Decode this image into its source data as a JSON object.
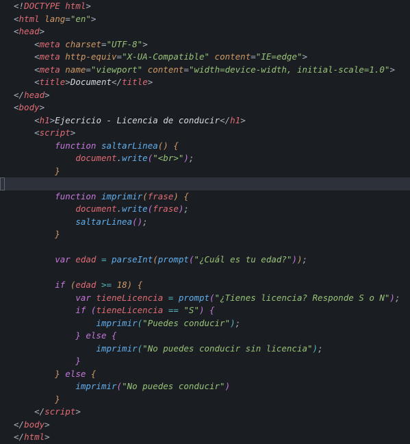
{
  "code": {
    "doctype": "DOCTYPE html",
    "html_tag": "html",
    "lang_attr": "lang",
    "lang_val": "\"en\"",
    "head_tag": "head",
    "meta_tag": "meta",
    "charset_attr": "charset",
    "charset_val": "\"UTF-8\"",
    "httpequiv_attr": "http-equiv",
    "httpequiv_val": "\"X-UA-Compatible\"",
    "content_attr": "content",
    "content_val1": "\"IE=edge\"",
    "name_attr": "name",
    "name_val": "\"viewport\"",
    "content_val2": "\"width=device-width, initial-scale=1.0\"",
    "title_tag": "title",
    "title_text": "Document",
    "body_tag": "body",
    "h1_tag": "h1",
    "h1_text": "Ejecricio - Licencia de conducir",
    "script_tag": "script",
    "function_kw": "function",
    "func_saltar": "saltarLinea",
    "func_imprimir": "imprimir",
    "param_frase": "frase",
    "document_obj": "document",
    "write_method": "write",
    "br_str": "\"<br>\"",
    "var_kw": "var",
    "var_edad": "edad",
    "parseInt_fn": "parseInt",
    "prompt_fn": "prompt",
    "prompt_edad": "\"¿Cuál es tu edad?\"",
    "if_kw": "if",
    "else_kw": "else",
    "gte": ">=",
    "eq": "==",
    "num_18": "18",
    "var_licencia": "tieneLicencia",
    "prompt_licencia": "\"¿Tienes licencia? Responde S o N\"",
    "str_S": "\"S\"",
    "str_puedes": "\"Puedes conducir\"",
    "str_sinlic": "\"No puedes conducir sin licencia\"",
    "str_nopuedes": "\"No puedes conducir\""
  }
}
